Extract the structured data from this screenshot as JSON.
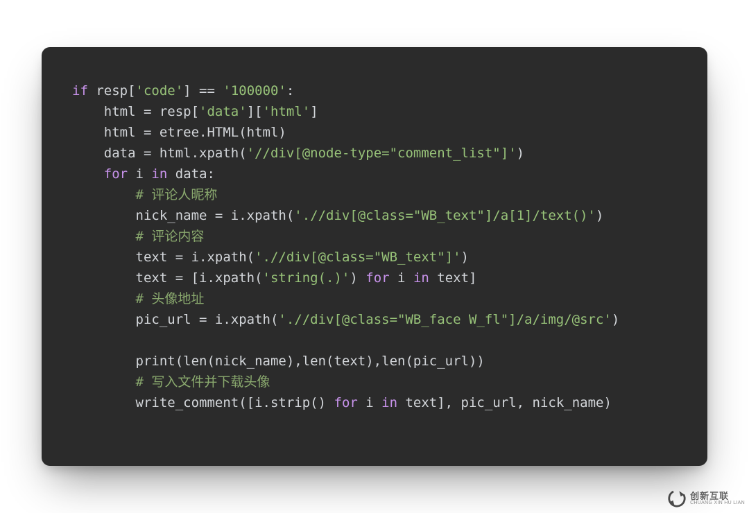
{
  "watermark": {
    "cn": "创新互联",
    "py": "CHUANG XIN HU LIAN"
  },
  "code": {
    "lines": [
      {
        "indent": 0,
        "tokens": [
          {
            "c": "kw",
            "t": "if"
          },
          {
            "c": "id",
            "t": " resp["
          },
          {
            "c": "str",
            "t": "'code'"
          },
          {
            "c": "id",
            "t": "] == "
          },
          {
            "c": "str",
            "t": "'100000'"
          },
          {
            "c": "id",
            "t": ":"
          }
        ]
      },
      {
        "indent": 1,
        "tokens": [
          {
            "c": "id",
            "t": "html = resp["
          },
          {
            "c": "str",
            "t": "'data'"
          },
          {
            "c": "id",
            "t": "]["
          },
          {
            "c": "str",
            "t": "'html'"
          },
          {
            "c": "id",
            "t": "]"
          }
        ]
      },
      {
        "indent": 1,
        "tokens": [
          {
            "c": "id",
            "t": "html = etree.HTML(html)"
          }
        ]
      },
      {
        "indent": 1,
        "tokens": [
          {
            "c": "id",
            "t": "data = html.xpath("
          },
          {
            "c": "str",
            "t": "'//div[@node-type=\"comment_list\"]'"
          },
          {
            "c": "id",
            "t": ")"
          }
        ]
      },
      {
        "indent": 1,
        "tokens": [
          {
            "c": "kw",
            "t": "for"
          },
          {
            "c": "id",
            "t": " i "
          },
          {
            "c": "kw",
            "t": "in"
          },
          {
            "c": "id",
            "t": " data:"
          }
        ]
      },
      {
        "indent": 2,
        "tokens": [
          {
            "c": "com",
            "t": "# 评论人昵称"
          }
        ]
      },
      {
        "indent": 2,
        "tokens": [
          {
            "c": "id",
            "t": "nick_name = i.xpath("
          },
          {
            "c": "str",
            "t": "'.//div[@class=\"WB_text\"]/a[1]/text()'"
          },
          {
            "c": "id",
            "t": ")"
          }
        ]
      },
      {
        "indent": 2,
        "tokens": [
          {
            "c": "com",
            "t": "# 评论内容"
          }
        ]
      },
      {
        "indent": 2,
        "tokens": [
          {
            "c": "id",
            "t": "text = i.xpath("
          },
          {
            "c": "str",
            "t": "'.//div[@class=\"WB_text\"]'"
          },
          {
            "c": "id",
            "t": ")"
          }
        ]
      },
      {
        "indent": 2,
        "tokens": [
          {
            "c": "id",
            "t": "text = [i.xpath("
          },
          {
            "c": "str",
            "t": "'string(.)'"
          },
          {
            "c": "id",
            "t": ") "
          },
          {
            "c": "kw",
            "t": "for"
          },
          {
            "c": "id",
            "t": " i "
          },
          {
            "c": "kw",
            "t": "in"
          },
          {
            "c": "id",
            "t": " text]"
          }
        ]
      },
      {
        "indent": 2,
        "tokens": [
          {
            "c": "com",
            "t": "# 头像地址"
          }
        ]
      },
      {
        "indent": 2,
        "tokens": [
          {
            "c": "id",
            "t": "pic_url = i.xpath("
          },
          {
            "c": "str",
            "t": "'.//div[@class=\"WB_face W_fl\"]/a/img/@src'"
          },
          {
            "c": "id",
            "t": ")"
          }
        ]
      },
      {
        "indent": 2,
        "tokens": [
          {
            "c": "id",
            "t": ""
          }
        ]
      },
      {
        "indent": 2,
        "tokens": [
          {
            "c": "id",
            "t": "print(len(nick_name),len(text),len(pic_url))"
          }
        ]
      },
      {
        "indent": 2,
        "tokens": [
          {
            "c": "com",
            "t": "# 写入文件并下载头像"
          }
        ]
      },
      {
        "indent": 2,
        "tokens": [
          {
            "c": "id",
            "t": "write_comment([i.strip() "
          },
          {
            "c": "kw",
            "t": "for"
          },
          {
            "c": "id",
            "t": " i "
          },
          {
            "c": "kw",
            "t": "in"
          },
          {
            "c": "id",
            "t": " text], pic_url, nick_name)"
          }
        ]
      }
    ],
    "indent_unit": "    "
  }
}
